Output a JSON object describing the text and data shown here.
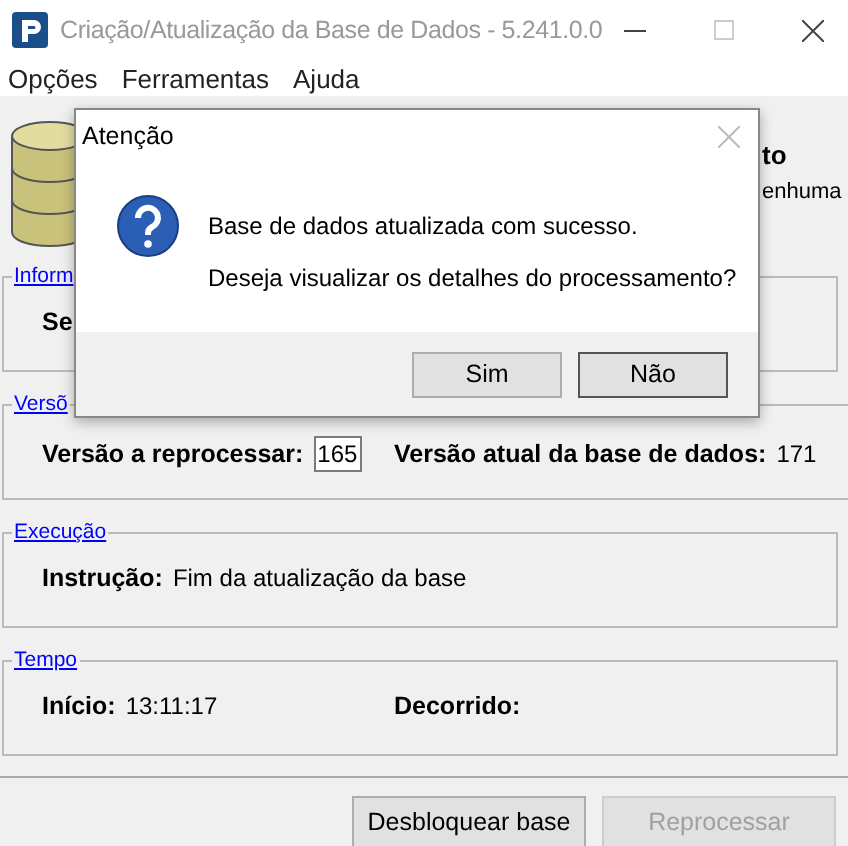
{
  "window": {
    "title": "Criação/Atualização da Base de Dados - 5.241.0.0"
  },
  "menu": [
    "Opções",
    "Ferramentas",
    "Ajuda"
  ],
  "header": {
    "title_fragment": "to",
    "subtitle_fragment": "enhuma"
  },
  "groups": [
    {
      "legend": "Inform",
      "fields": [
        {
          "kind": "text",
          "label": "Se"
        }
      ]
    },
    {
      "legend": "Versõ",
      "fields": [
        {
          "kind": "input",
          "label": "Versão a reprocessar:",
          "value": "165"
        },
        {
          "kind": "text",
          "label": "Versão atual da base de dados:",
          "value": "171"
        }
      ]
    },
    {
      "legend": "Execução",
      "fields": [
        {
          "kind": "text",
          "label": "Instrução:",
          "value": "Fim da atualização da base"
        }
      ]
    },
    {
      "legend": "Tempo",
      "fields": [
        {
          "kind": "text",
          "label": "Início:",
          "value": "13:11:17"
        },
        {
          "kind": "text",
          "label": "Decorrido:"
        }
      ]
    }
  ],
  "buttons": [
    {
      "label": "Desbloquear base",
      "disabled": false
    },
    {
      "label": "Reprocessar",
      "disabled": true
    }
  ],
  "dialog": {
    "title": "Atenção",
    "messages": [
      "Base de dados atualizada com sucesso.",
      "Deseja visualizar os detalhes do processamento?"
    ],
    "buttons": [
      {
        "label": "Sim",
        "focused": false
      },
      {
        "label": "Não",
        "focused": true
      }
    ]
  }
}
